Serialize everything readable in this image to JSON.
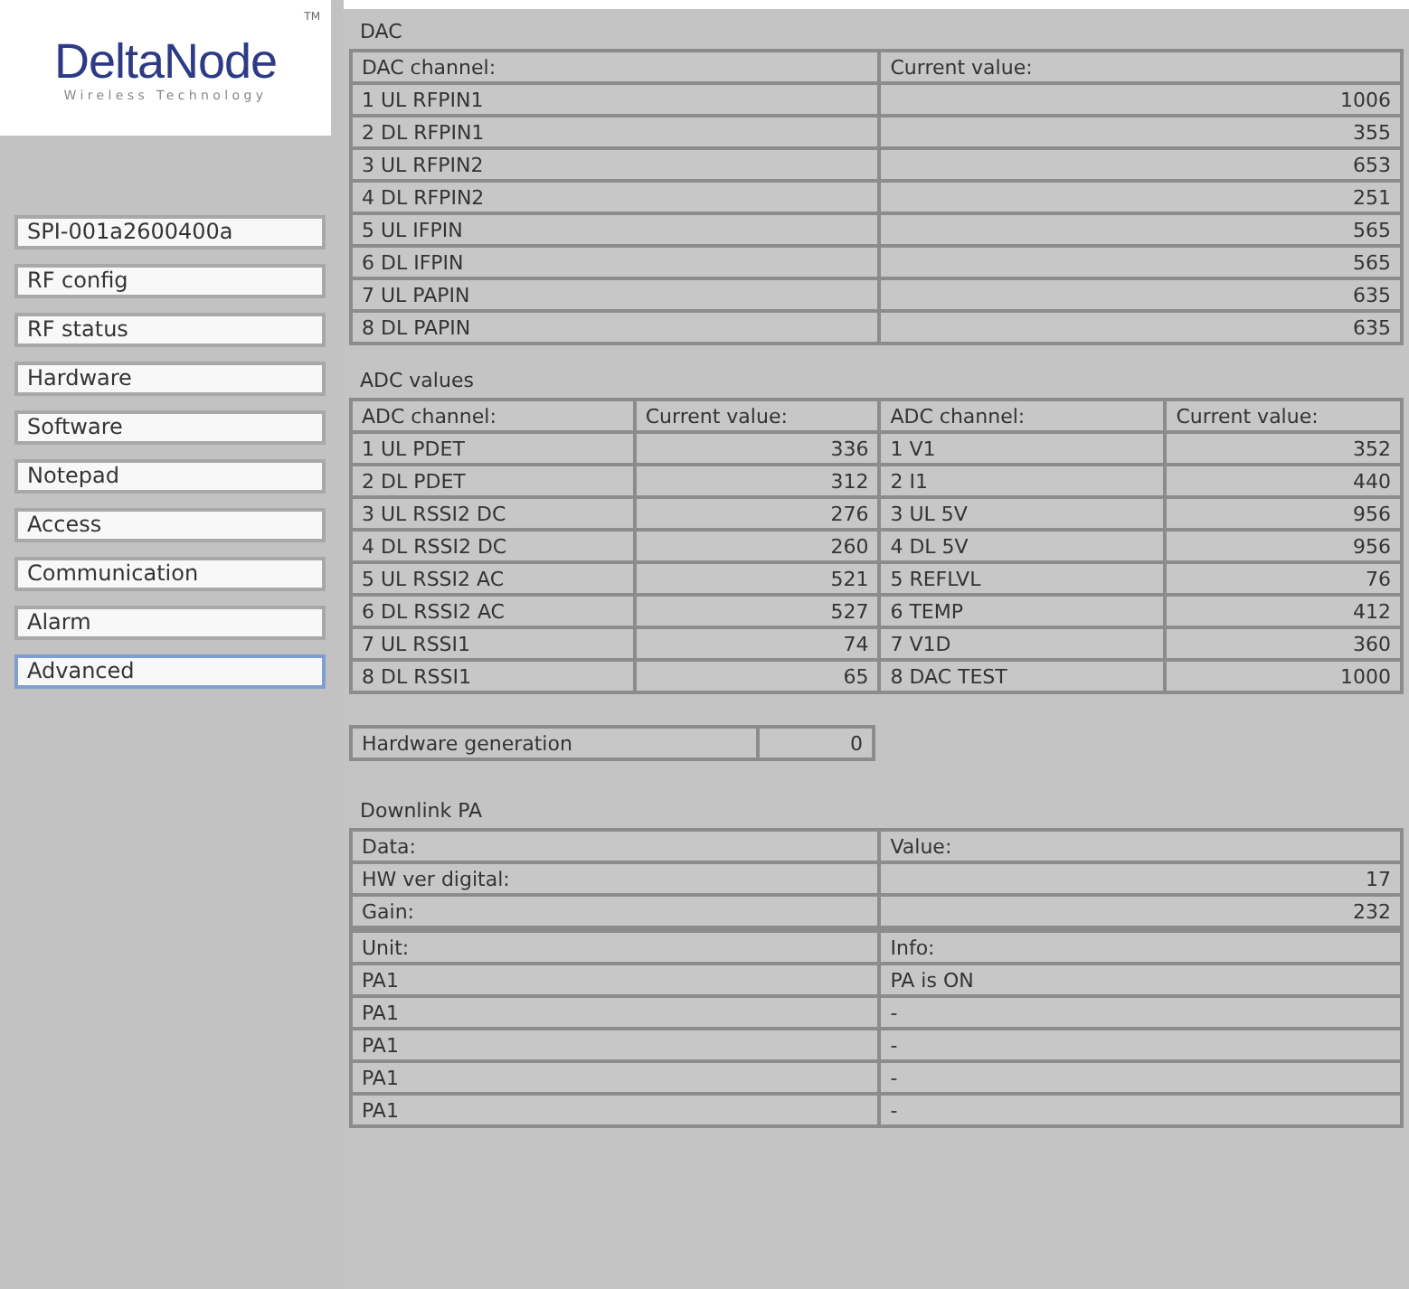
{
  "sidebar": {
    "logo": {
      "name": "DeltaNode",
      "tagline": "Wireless Technology",
      "trademark": "TM"
    },
    "items": [
      {
        "label": "SPI-001a2600400a",
        "selected": false
      },
      {
        "label": "RF config",
        "selected": false
      },
      {
        "label": "RF status",
        "selected": false
      },
      {
        "label": "Hardware",
        "selected": false
      },
      {
        "label": "Software",
        "selected": false
      },
      {
        "label": "Notepad",
        "selected": false
      },
      {
        "label": "Access",
        "selected": false
      },
      {
        "label": "Communication",
        "selected": false
      },
      {
        "label": "Alarm",
        "selected": false
      },
      {
        "label": "Advanced",
        "selected": true
      }
    ]
  },
  "dac": {
    "title": "DAC",
    "columns": [
      "DAC channel:",
      "Current value:"
    ],
    "rows": [
      {
        "channel": "1 UL RFPIN1",
        "value": "1006"
      },
      {
        "channel": "2 DL RFPIN1",
        "value": "355"
      },
      {
        "channel": "3 UL RFPIN2",
        "value": "653"
      },
      {
        "channel": "4 DL RFPIN2",
        "value": "251"
      },
      {
        "channel": "5 UL IFPIN",
        "value": "565"
      },
      {
        "channel": "6 DL IFPIN",
        "value": "565"
      },
      {
        "channel": "7 UL PAPIN",
        "value": "635"
      },
      {
        "channel": "8 DL PAPIN",
        "value": "635"
      }
    ]
  },
  "adc": {
    "title": "ADC values",
    "columns": [
      "ADC channel:",
      "Current value:",
      "ADC channel:",
      "Current value:"
    ],
    "rows": [
      {
        "channel_1": "1 UL PDET",
        "value_1": "336",
        "channel_2": "1 V1",
        "value_2": "352"
      },
      {
        "channel_1": "2 DL PDET",
        "value_1": "312",
        "channel_2": "2 I1",
        "value_2": "440"
      },
      {
        "channel_1": "3 UL RSSI2 DC",
        "value_1": "276",
        "channel_2": "3 UL 5V",
        "value_2": "956"
      },
      {
        "channel_1": "4 DL RSSI2 DC",
        "value_1": "260",
        "channel_2": "4 DL 5V",
        "value_2": "956"
      },
      {
        "channel_1": "5 UL RSSI2 AC",
        "value_1": "521",
        "channel_2": "5 REFLVL",
        "value_2": "76"
      },
      {
        "channel_1": "6 DL RSSI2 AC",
        "value_1": "527",
        "channel_2": "6 TEMP",
        "value_2": "412"
      },
      {
        "channel_1": "7 UL RSSI1",
        "value_1": "74",
        "channel_2": "7 V1D",
        "value_2": "360"
      },
      {
        "channel_1": "8 DL RSSI1",
        "value_1": "65",
        "channel_2": "8 DAC TEST",
        "value_2": "1000"
      }
    ]
  },
  "hardware_generation": {
    "label": "Hardware generation",
    "value": "0"
  },
  "downlink_pa": {
    "title": "Downlink PA",
    "data_columns": [
      "Data:",
      "Value:"
    ],
    "data_rows": [
      {
        "data": "HW ver digital:",
        "value": "17"
      },
      {
        "data": "Gain:",
        "value": "232"
      }
    ],
    "unit_columns": [
      "Unit:",
      "Info:"
    ],
    "unit_rows": [
      {
        "unit": "PA1",
        "info": "PA is ON"
      },
      {
        "unit": "PA1",
        "info": "-"
      },
      {
        "unit": "PA1",
        "info": "-"
      },
      {
        "unit": "PA1",
        "info": "-"
      },
      {
        "unit": "PA1",
        "info": "-"
      }
    ]
  }
}
